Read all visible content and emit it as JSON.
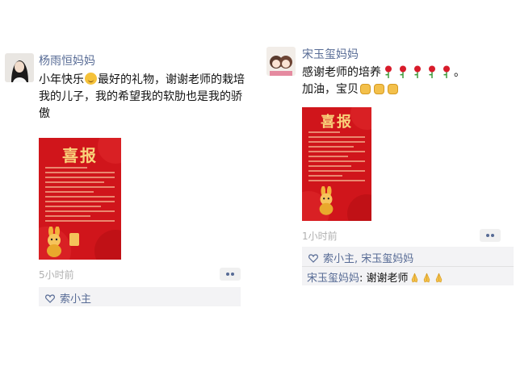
{
  "posts": [
    {
      "author": "杨雨恒妈妈",
      "text_1": "小年快乐",
      "text_2": "最好的礼物，谢谢老师的栽培\n我的儿子，我的希望我的软肋也是我的骄傲",
      "poster_title": "喜报",
      "time": "5小时前",
      "likes": "索小主"
    },
    {
      "author": "宋玉玺妈妈",
      "text_1": "感谢老师的培养",
      "text_1_end": "。",
      "text_2": "加油，宝贝",
      "poster_title": "喜报",
      "time": "1小时前",
      "likes": "索小主, 宋玉玺妈妈",
      "comment_author": "宋玉玺妈妈",
      "comment_text": ": 谢谢老师"
    }
  ],
  "colors": {
    "link_blue": "#576b95",
    "poster_red": "#d0151b",
    "poster_gold": "#f9d27a"
  },
  "icons": [
    "smile-emoji-icon",
    "rose-emoji-icon",
    "fist-emoji-icon",
    "pray-emoji-icon",
    "heart-icon",
    "more-icon"
  ]
}
